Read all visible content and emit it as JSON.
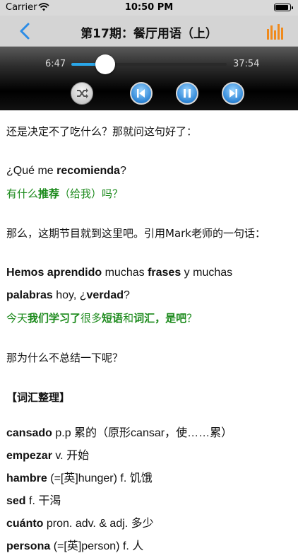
{
  "status": {
    "carrier": "Carrier",
    "time": "10:50 PM"
  },
  "nav": {
    "title": "第17期：餐厅用语（上）"
  },
  "player": {
    "elapsed": "6:47",
    "total": "37:54",
    "progress": 0.22
  },
  "content": {
    "l1": "还是决定不了吃什么？那就问这句好了：",
    "l2": {
      "a": "¿Qué me ",
      "b": "recomienda",
      "c": "?"
    },
    "l3": {
      "a": "有什么",
      "b": "推荐",
      "c": "（给我）吗？"
    },
    "l4": "那么，这期节目就到这里吧。引用Mark老师的一句话：",
    "l5": {
      "a": "Hemos aprendido",
      "b": " muchas ",
      "c": "frases",
      "d": " y muchas"
    },
    "l6": {
      "a": "palabras",
      "b": " hoy, ¿",
      "c": "verdad",
      "d": "?"
    },
    "l7": {
      "a": "今天",
      "b": "我们学习了",
      "c": "很多",
      "d": "短语",
      "e": "和",
      "f": "词汇，是吧",
      "g": "？"
    },
    "l8": "那为什么不总结一下呢？",
    "section": "【词汇整理】",
    "vocab": [
      {
        "word": "cansado",
        "def": " p.p 累的（原形cansar，使……累）"
      },
      {
        "word": "empezar",
        "def": " v. 开始"
      },
      {
        "word": "hambre",
        "def": " (=[英]hunger) f. 饥饿"
      },
      {
        "word": "sed",
        "def": " f. 干渴"
      },
      {
        "word": "cuánto",
        "def": " pron. adv. & adj. 多少"
      },
      {
        "word": "persona",
        "def": " (=[英]person) f. 人"
      }
    ]
  }
}
